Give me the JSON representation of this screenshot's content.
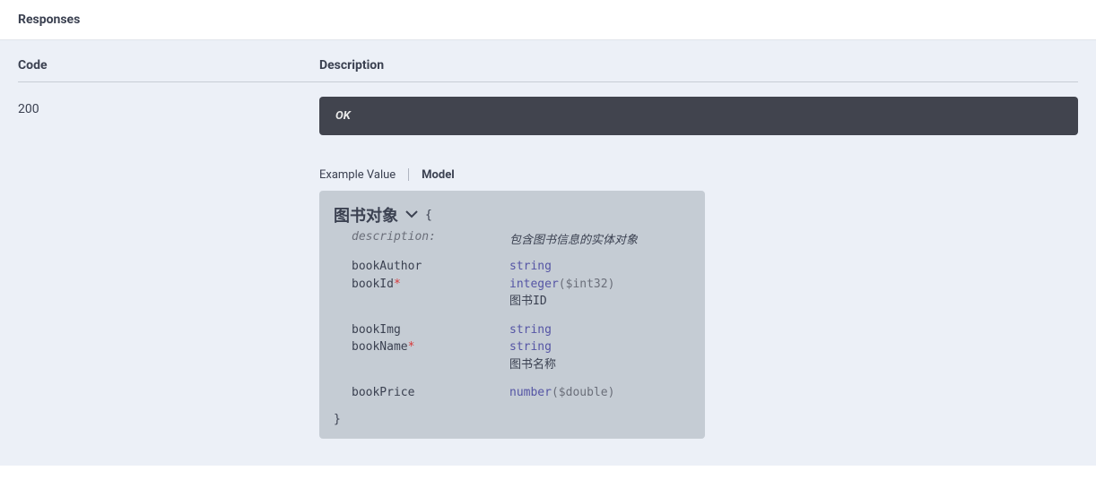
{
  "section_title": "Responses",
  "headers": {
    "code": "Code",
    "description": "Description"
  },
  "response": {
    "code": "200",
    "status_text": "OK"
  },
  "tabs": {
    "example": "Example Value",
    "model": "Model"
  },
  "model": {
    "title": "图书对象",
    "open_brace": "{",
    "close_brace": "}",
    "description_label": "description:",
    "description_value": "包含图书信息的实体对象",
    "props": {
      "bookAuthor": {
        "name": "bookAuthor",
        "type": "string"
      },
      "bookId": {
        "name": "bookId",
        "required_mark": "*",
        "type": "integer",
        "format": "($int32)",
        "note": "图书ID"
      },
      "bookImg": {
        "name": "bookImg",
        "type": "string"
      },
      "bookName": {
        "name": "bookName",
        "required_mark": "*",
        "type": "string",
        "note": "图书名称"
      },
      "bookPrice": {
        "name": "bookPrice",
        "type": "number",
        "format": "($double)"
      }
    }
  }
}
